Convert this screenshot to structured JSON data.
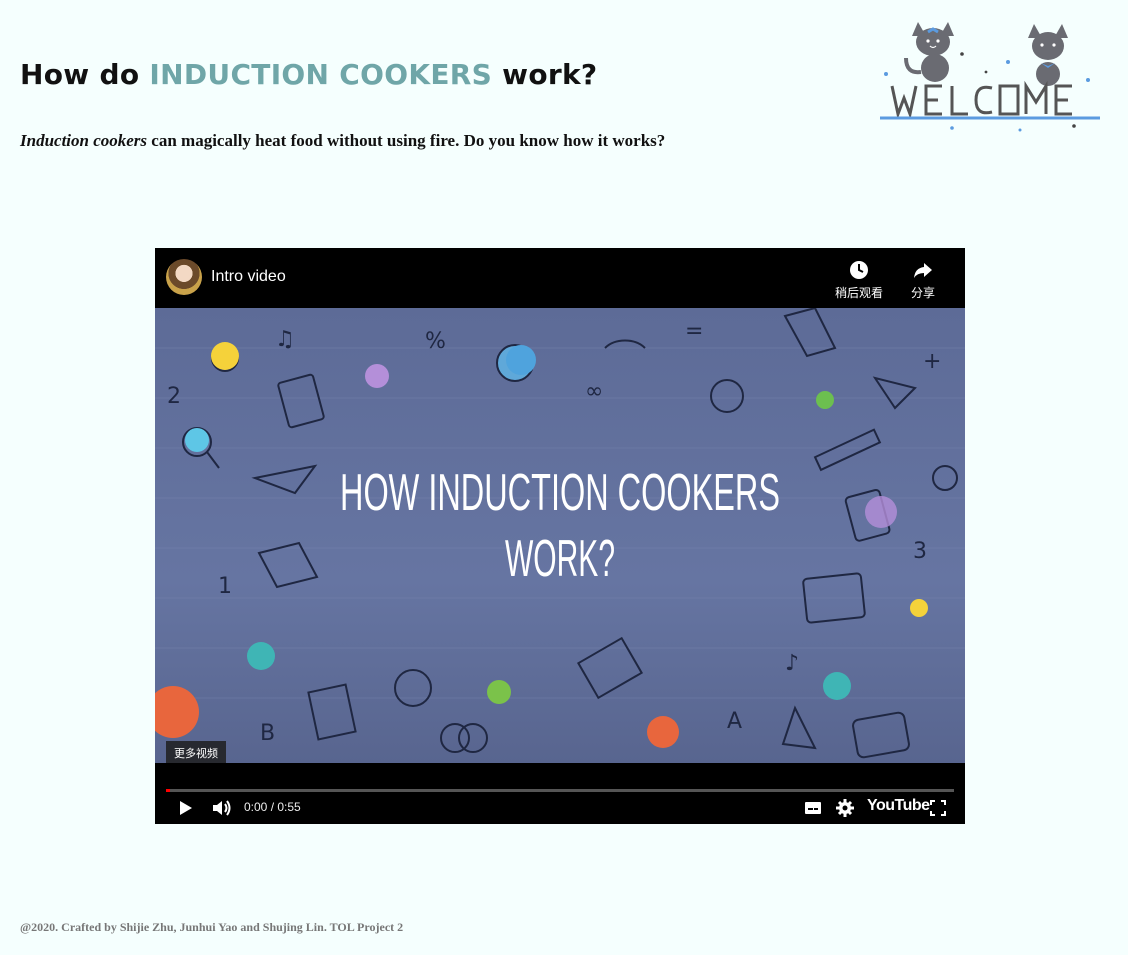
{
  "page": {
    "title_prefix": "How do ",
    "title_accent": "INDUCTION COOKERS",
    "title_suffix": " work?",
    "intro_em": "Induction cookers",
    "intro_rest": " can magically heat food without using fire. Do you know how it works?",
    "welcome_logo_text": "WELCOME"
  },
  "player": {
    "video_title": "Intro video",
    "watch_later_label": "稍后观看",
    "share_label": "分享",
    "thumbnail_title_line1": "HOW INDUCTION COOKERS",
    "thumbnail_title_line2": "WORK?",
    "more_videos_label": "更多视频",
    "time_display": "0:00 / 0:55",
    "progress": 0.0,
    "youtube_label": "YouTube"
  },
  "footer": {
    "credit": "@2020. Crafted by Shijie Zhu, Junhui Yao and Shujing Lin. TOL Project 2"
  },
  "colors": {
    "accent": "#6fa6a8",
    "background": "#f5fffe",
    "thumbnail_bg": "#5f6e99"
  }
}
